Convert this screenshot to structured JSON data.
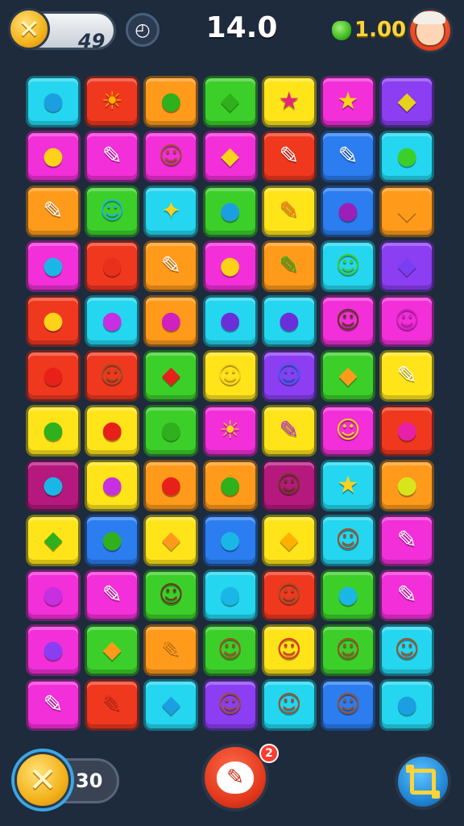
{
  "header": {
    "left_counter": "49",
    "timer": "14.0",
    "gems": "1.00",
    "icons": {
      "left_badge": "x-icon",
      "clock": "clock-icon",
      "gem": "gem-icon",
      "avatar": "avatar-icon"
    }
  },
  "board": {
    "rows": 12,
    "cols": 7,
    "palette": {
      "cyan": "#24d6ef",
      "red": "#f0381f",
      "orange": "#ff9a1a",
      "green": "#3ccf2a",
      "yellow": "#ffe41a",
      "magenta": "#f22fd8",
      "purple": "#8b3ef2",
      "blue": "#2b7df0",
      "maroon": "#b5197e"
    },
    "tiles": [
      [
        "cyan",
        "red",
        "orange",
        "green",
        "yellow",
        "magenta",
        "purple"
      ],
      [
        "magenta",
        "magenta",
        "magenta",
        "magenta",
        "red",
        "blue",
        "cyan"
      ],
      [
        "orange",
        "green",
        "cyan",
        "green",
        "yellow",
        "blue",
        "orange"
      ],
      [
        "magenta",
        "red",
        "orange",
        "magenta",
        "orange",
        "cyan",
        "purple"
      ],
      [
        "red",
        "cyan",
        "orange",
        "cyan",
        "cyan",
        "magenta",
        "magenta"
      ],
      [
        "red",
        "red",
        "green",
        "yellow",
        "purple",
        "green",
        "yellow"
      ],
      [
        "yellow",
        "yellow",
        "green",
        "magenta",
        "yellow",
        "magenta",
        "red"
      ],
      [
        "maroon",
        "yellow",
        "orange",
        "orange",
        "maroon",
        "cyan",
        "orange"
      ],
      [
        "yellow",
        "blue",
        "yellow",
        "blue",
        "yellow",
        "cyan",
        "magenta"
      ],
      [
        "magenta",
        "magenta",
        "green",
        "cyan",
        "red",
        "green",
        "magenta"
      ],
      [
        "magenta",
        "green",
        "orange",
        "green",
        "yellow",
        "green",
        "cyan"
      ],
      [
        "magenta",
        "red",
        "cyan",
        "purple",
        "cyan",
        "blue",
        "cyan"
      ]
    ],
    "symbols": [
      [
        "●",
        "☀",
        "●",
        "◆",
        "★",
        "★",
        "◆"
      ],
      [
        "●",
        "✎",
        "☺",
        "◆",
        "✎",
        "✎",
        "●"
      ],
      [
        "✎",
        "☺",
        "✦",
        "●",
        "✎",
        "●",
        "◆"
      ],
      [
        "●",
        "●",
        "✎",
        "●",
        "✎",
        "☺",
        "◆"
      ],
      [
        "●",
        "●",
        "●",
        "●",
        "●",
        "☺",
        "☺"
      ],
      [
        "●",
        "☺",
        "◆",
        "☺",
        "☺",
        "◆",
        "✎"
      ],
      [
        "●",
        "●",
        "●",
        "☀",
        "✎",
        "☺",
        "●"
      ],
      [
        "●",
        "●",
        "●",
        "●",
        "☺",
        "★",
        "●"
      ],
      [
        "◆",
        "●",
        "◆",
        "●",
        "◆",
        "☺",
        "✎"
      ],
      [
        "●",
        "✎",
        "☺",
        "●",
        "☺",
        "●",
        "✎"
      ],
      [
        "●",
        "◆",
        "✎",
        "☺",
        "☺",
        "☺",
        "☺"
      ],
      [
        "✎",
        "✎",
        "◆",
        "☺",
        "☺",
        "☺",
        "●"
      ]
    ],
    "symbol_colors": [
      [
        "#1c9fe0",
        "#ffb000",
        "#2fb01c",
        "#2fb01c",
        "#e8247a",
        "#ffd21a",
        "#e6d21a"
      ],
      [
        "#ffd21a",
        "#ffffff",
        "#a0502a",
        "#ffd21a",
        "#ffffff",
        "#ffffff",
        "#3ccf2a"
      ],
      [
        "#ffffff",
        "#1ab7d6",
        "#ffd21a",
        "#1c9fe0",
        "#ff7a1a",
        "#9b1fb8",
        "#ff9a1a"
      ],
      [
        "#1ab7e6",
        "#e8301a",
        "#ffffff",
        "#ffd21a",
        "#2fb01c",
        "#3ccf2a",
        "#7a3ef2"
      ],
      [
        "#ffd21a",
        "#c630e0",
        "#d020c0",
        "#6a2fd8",
        "#6a2fd8",
        "#5a3a1a",
        "#d020c0"
      ],
      [
        "#e8201a",
        "#a0502a",
        "#e8201a",
        "#ffd21a",
        "#3a60f0",
        "#ff9a1a",
        "#ffffff"
      ],
      [
        "#2fb01c",
        "#e8201a",
        "#2fb01c",
        "#ffd21a",
        "#c630e0",
        "#ffd21a",
        "#e820a8"
      ],
      [
        "#1ab7e6",
        "#c630e0",
        "#e8201a",
        "#2fb01c",
        "#6a3a1a",
        "#ffd21a",
        "#d6e61a"
      ],
      [
        "#2fb01c",
        "#2fb01c",
        "#ff9a1a",
        "#1ab7e6",
        "#ffb000",
        "#a0502a",
        "#ffffff"
      ],
      [
        "#c630e0",
        "#ffffff",
        "#6a3a1a",
        "#1ab7e6",
        "#a0502a",
        "#1ab7e6",
        "#ffffff"
      ],
      [
        "#8a3ef2",
        "#ff9a1a",
        "#ff9a1a",
        "#a0502a",
        "#e8301a",
        "#a0502a",
        "#a0502a"
      ],
      [
        "#ffffff",
        "#e8301a",
        "#1c9fe0",
        "#a0502a",
        "#a0502a",
        "#a0502a",
        "#1c9fe0"
      ]
    ]
  },
  "footer": {
    "counter": "30",
    "hint_badge": "2",
    "icons": {
      "left_badge": "x-icon",
      "hint": "hint-icon",
      "shuffle": "shuffle-icon"
    }
  }
}
